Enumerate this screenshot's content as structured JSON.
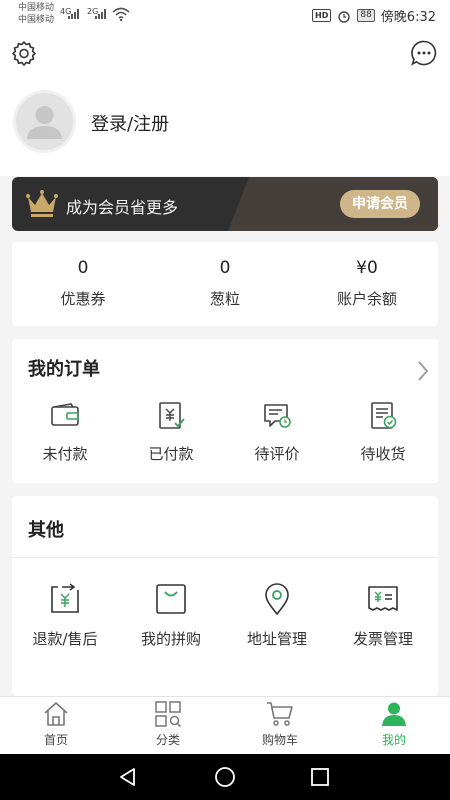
{
  "status": {
    "carrier_1": "中国移动",
    "carrier_2": "中国移动",
    "net_1": "4G",
    "net_2": "2G",
    "hd": "HD",
    "battery": "88",
    "time": "傍晚6:32"
  },
  "header": {
    "login_text": "登录/注册",
    "settings_icon": "gear-icon",
    "message_icon": "chat-bubble-icon"
  },
  "member": {
    "text": "成为会员省更多",
    "button": "申请会员",
    "accent": "#cfb68a"
  },
  "stats": [
    {
      "value": "0",
      "label": "优惠券"
    },
    {
      "value": "0",
      "label": "葱粒"
    },
    {
      "value": "¥0",
      "label": "账户余额"
    }
  ],
  "orders": {
    "title": "我的订单",
    "items": [
      {
        "label": "未付款",
        "icon": "wallet-icon"
      },
      {
        "label": "已付款",
        "icon": "paid-receipt-icon"
      },
      {
        "label": "待评价",
        "icon": "comment-icon"
      },
      {
        "label": "待收货",
        "icon": "delivery-receipt-icon"
      }
    ]
  },
  "others": {
    "title": "其他",
    "items": [
      {
        "label": "退款/售后",
        "icon": "refund-icon"
      },
      {
        "label": "我的拼购",
        "icon": "shopping-bag-icon"
      },
      {
        "label": "地址管理",
        "icon": "location-pin-icon"
      },
      {
        "label": "发票管理",
        "icon": "invoice-icon"
      }
    ]
  },
  "tabs": [
    {
      "label": "首页",
      "icon": "home-icon",
      "active": false
    },
    {
      "label": "分类",
      "icon": "category-grid-icon",
      "active": false
    },
    {
      "label": "购物车",
      "icon": "cart-icon",
      "active": false
    },
    {
      "label": "我的",
      "icon": "person-icon",
      "active": true
    }
  ],
  "colors": {
    "brand_green": "#2db35a",
    "icon_green": "#3aa35e",
    "member_bg": "#2f2f2f"
  }
}
